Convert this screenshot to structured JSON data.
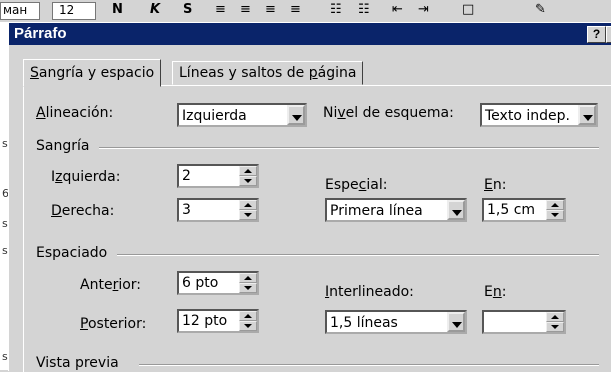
{
  "toolbar": {
    "font_value": "ман",
    "size_value": "12",
    "bold": "N",
    "italic": "K",
    "underline": "S"
  },
  "document": {
    "margin_chars": [
      "s",
      "6",
      "s",
      "s",
      "s"
    ]
  },
  "dialog": {
    "title": "Párrafo",
    "help_button": "?",
    "tabs": [
      {
        "label": "Sangría y espacio",
        "accel": "S",
        "active": true
      },
      {
        "label": "Líneas y saltos de página",
        "accel": "p",
        "active": false
      }
    ],
    "alineacion": {
      "label": "Alineación:",
      "value": "Izquierda"
    },
    "nivel_esquema": {
      "label": "Nivel de esquema:",
      "value": "Texto indep."
    },
    "sangria": {
      "group_label": "Sangría",
      "izquierda": {
        "label": "Izquierda:",
        "value": "2"
      },
      "derecha": {
        "label": "Derecha:",
        "value": "3"
      },
      "especial": {
        "label": "Especial:",
        "value": "Primera línea"
      },
      "en": {
        "label": "En:",
        "value": "1,5 cm"
      }
    },
    "espaciado": {
      "group_label": "Espaciado",
      "anterior": {
        "label": "Anterior:",
        "value": "6 pto"
      },
      "posterior": {
        "label": "Posterior:",
        "value": "12 pto"
      },
      "interlineado": {
        "label": "Interlineado:",
        "value": "1,5 líneas"
      },
      "en": {
        "label": "En:",
        "value": ""
      }
    },
    "vista_previa": {
      "group_label": "Vista previa"
    }
  }
}
